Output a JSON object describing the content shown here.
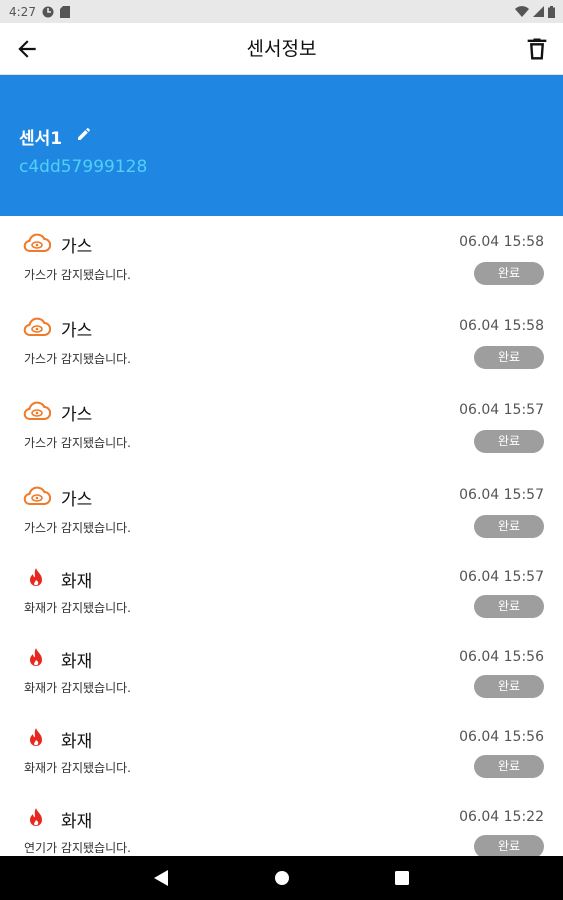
{
  "status_bar": {
    "time": "4:27"
  },
  "app_bar": {
    "title": "센서정보"
  },
  "sensor": {
    "name": "센서1",
    "id": "c4dd57999128"
  },
  "colors": {
    "header_bg": "#1f87e1",
    "gas_icon": "#f07a2a",
    "fire_icon": "#e8281f",
    "badge_bg": "#9e9e9e"
  },
  "events": [
    {
      "icon": "gas-cloud-icon",
      "type": "가스",
      "time": "06.04 15:58",
      "message": "가스가 감지됐습니다.",
      "status": "완료"
    },
    {
      "icon": "gas-cloud-icon",
      "type": "가스",
      "time": "06.04 15:58",
      "message": "가스가 감지됐습니다.",
      "status": "완료"
    },
    {
      "icon": "gas-cloud-icon",
      "type": "가스",
      "time": "06.04 15:57",
      "message": "가스가 감지됐습니다.",
      "status": "완료"
    },
    {
      "icon": "gas-cloud-icon",
      "type": "가스",
      "time": "06.04 15:57",
      "message": "가스가 감지됐습니다.",
      "status": "완료"
    },
    {
      "icon": "fire-icon",
      "type": "화재",
      "time": "06.04 15:57",
      "message": "화재가 감지됐습니다.",
      "status": "완료"
    },
    {
      "icon": "fire-icon",
      "type": "화재",
      "time": "06.04 15:56",
      "message": "화재가 감지됐습니다.",
      "status": "완료"
    },
    {
      "icon": "fire-icon",
      "type": "화재",
      "time": "06.04 15:56",
      "message": "화재가 감지됐습니다.",
      "status": "완료"
    },
    {
      "icon": "fire-icon",
      "type": "화재",
      "time": "06.04 15:22",
      "message": "연기가 감지됐습니다.",
      "status": "완료"
    }
  ]
}
